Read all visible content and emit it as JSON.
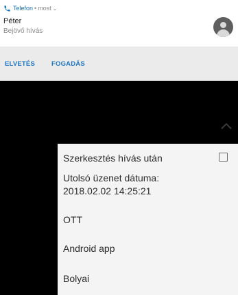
{
  "notification": {
    "app_name": "Telefon",
    "separator": "•",
    "time": "most",
    "caller_name": "Péter",
    "call_status": "Bejövő hívás",
    "icons": {
      "app": "phone-icon",
      "expand": "chevron-down-icon",
      "avatar": "person-avatar-icon"
    },
    "colors": {
      "accent": "#1e74c0",
      "avatar_bg": "#5f5f5f"
    }
  },
  "actions": {
    "reject_label": "ELVETÉS",
    "accept_label": "FOGADÁS"
  },
  "overlay": {
    "collapse_icon": "chevron-up-icon"
  },
  "menu": {
    "edit_after_call_label": "Szerkesztés hívás után",
    "edit_after_call_checked": false,
    "last_message_label": "Utolsó üzenet dátuma:",
    "last_message_value": "2018.02.02 14:25:21",
    "items": [
      {
        "label": "OTT"
      },
      {
        "label": "Android app"
      },
      {
        "label": "Bolyai"
      }
    ]
  }
}
